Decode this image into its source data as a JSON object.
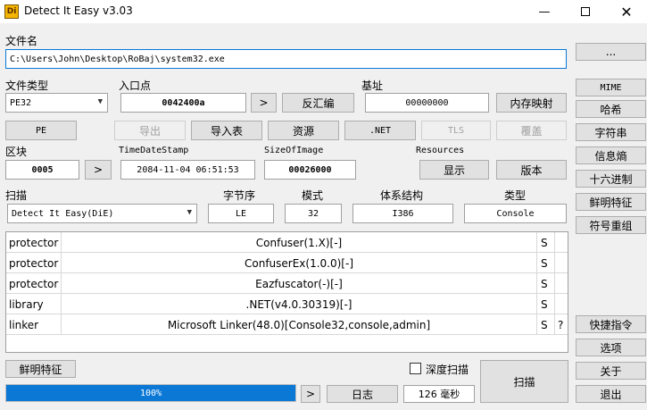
{
  "window": {
    "title": "Detect It Easy v3.03",
    "icon_text": "Di",
    "controls": [
      "minimize-icon",
      "maximize-icon",
      "close-icon"
    ]
  },
  "file": {
    "label": "文件名",
    "path": "C:\\Users\\John\\Desktop\\RoBaj\\system32.exe",
    "browse_label": "..."
  },
  "filetype": {
    "label": "文件类型",
    "value": "PE32"
  },
  "entry": {
    "label": "入口点",
    "value": "0042400a",
    "go_label": ">",
    "disasm_label": "反汇编"
  },
  "base": {
    "label": "基址",
    "value": "00000000",
    "memmap_label": "内存映射"
  },
  "toolbar": {
    "pe_label": "PE",
    "export_label": "导出",
    "import_label": "导入表",
    "resources_label": "资源",
    "net_label": ".NET",
    "tls_label": "TLS",
    "overlay_label": "覆盖"
  },
  "sections": {
    "label": "区块",
    "value": "0005",
    "go_label": ">"
  },
  "timestamp": {
    "label": "TimeDateStamp",
    "value": "2084-11-04 06:51:53"
  },
  "sizeofimage": {
    "label": "SizeOfImage",
    "value": "00026000"
  },
  "resources": {
    "label": "Resources",
    "show_label": "显示",
    "version_label": "版本"
  },
  "scan": {
    "label": "扫描",
    "engine": "Detect It Easy(DiE)",
    "endian_label": "字节序",
    "endian_value": "LE",
    "mode_label": "模式",
    "mode_value": "32",
    "arch_label": "体系结构",
    "arch_value": "I386",
    "type_label": "类型",
    "type_value": "Console"
  },
  "results": [
    {
      "type": "protector",
      "name": "Confuser(1.X)[-]",
      "s": "S",
      "q": ""
    },
    {
      "type": "protector",
      "name": "ConfuserEx(1.0.0)[-]",
      "s": "S",
      "q": ""
    },
    {
      "type": "protector",
      "name": "Eazfuscator(-)[-]",
      "s": "S",
      "q": ""
    },
    {
      "type": "library",
      "name": ".NET(v4.0.30319)[-]",
      "s": "S",
      "q": ""
    },
    {
      "type": "linker",
      "name": "Microsoft Linker(48.0)[Console32,console,admin]",
      "s": "S",
      "q": "?"
    }
  ],
  "sidebar": {
    "mime_label": "MIME",
    "hash_label": "哈希",
    "strings_label": "字符串",
    "entropy_label": "信息熵",
    "hex_label": "十六进制",
    "signatures_label": "鲜明特征",
    "demangle_label": "符号重组",
    "shortcuts_label": "快捷指令",
    "options_label": "选项",
    "about_label": "关于",
    "exit_label": "退出"
  },
  "bottom": {
    "signatures_label": "鲜明特征",
    "deep_scan_label": "深度扫描",
    "deep_scan_checked": false,
    "scan_label": "扫描",
    "progress": 100,
    "progress_text": "100%",
    "next_label": ">",
    "log_label": "日志",
    "time_value": "126 毫秒"
  },
  "colors": {
    "progress_fill": "#0b78d6",
    "window_bg": "#f0f0f0"
  }
}
